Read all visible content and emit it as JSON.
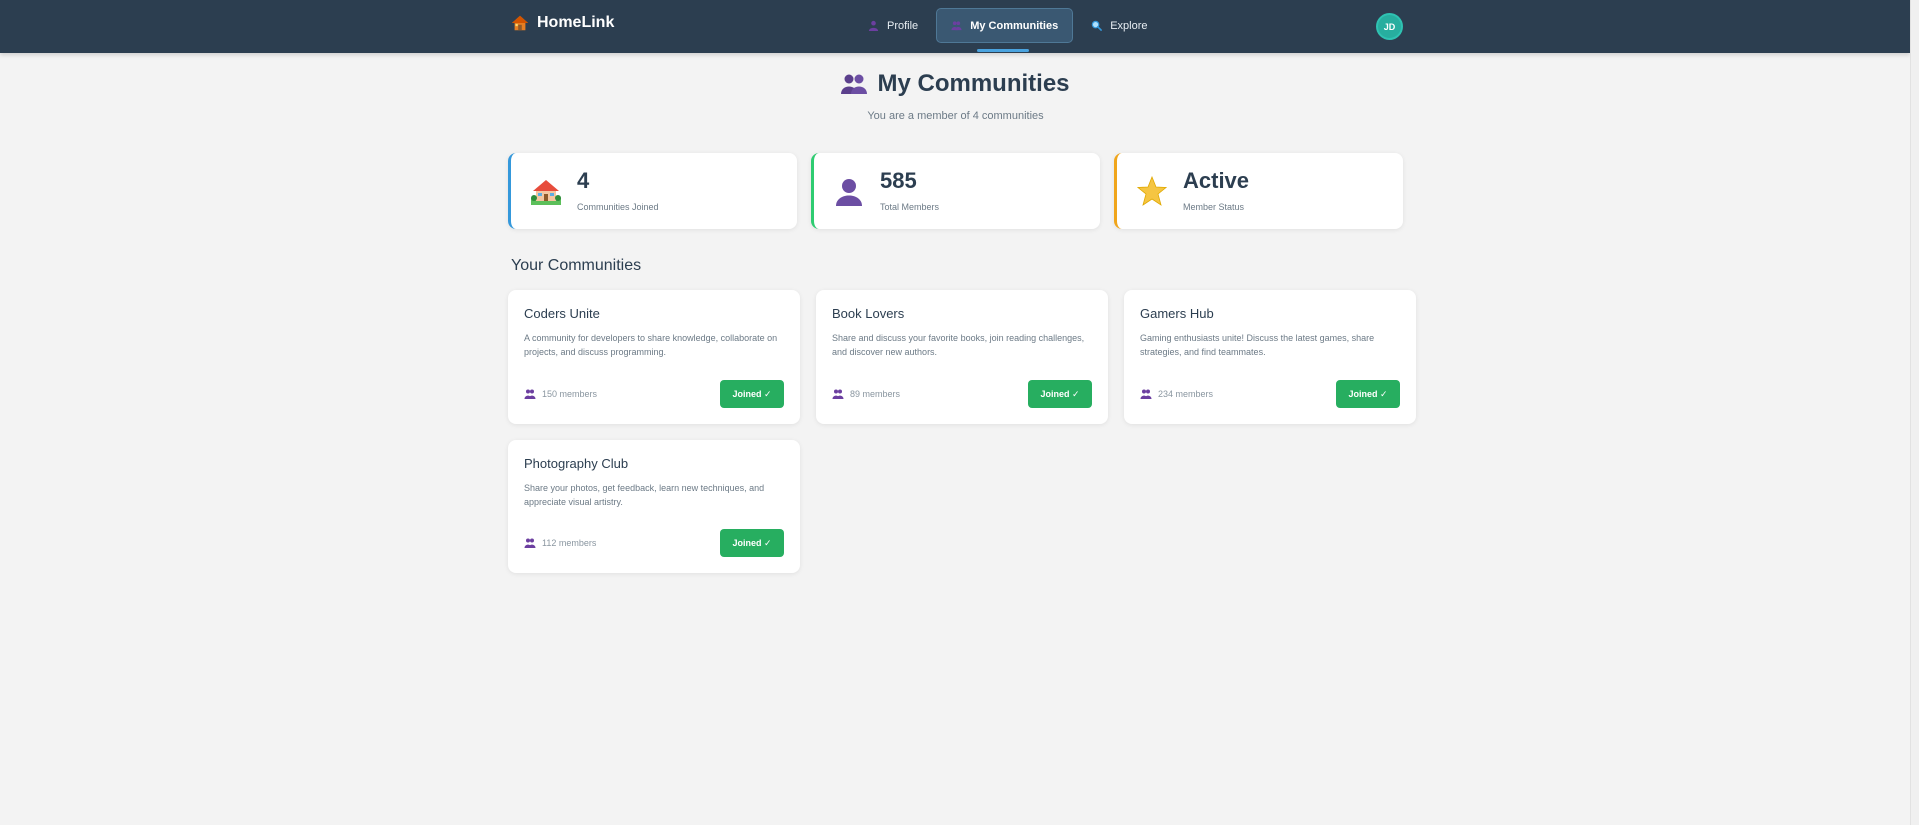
{
  "nav": {
    "brand": "HomeLink",
    "links": [
      {
        "label": "Profile"
      },
      {
        "label": "My Communities"
      },
      {
        "label": "Explore"
      }
    ],
    "avatar_initials": "JD"
  },
  "header": {
    "title": "My Communities",
    "subtitle": "You are a member of 4 communities"
  },
  "stats": [
    {
      "value": "4",
      "label": "Communities Joined"
    },
    {
      "value": "585",
      "label": "Total Members"
    },
    {
      "value": "Active",
      "label": "Member Status"
    }
  ],
  "section_title": "Your Communities",
  "communities": [
    {
      "name": "Coders Unite",
      "description": "A community for developers to share knowledge, collaborate on projects, and discuss programming.",
      "members": "150 members",
      "button": "Joined ✓"
    },
    {
      "name": "Book Lovers",
      "description": "Share and discuss your favorite books, join reading challenges, and discover new authors.",
      "members": "89 members",
      "button": "Joined ✓"
    },
    {
      "name": "Gamers Hub",
      "description": "Gaming enthusiasts unite! Discuss the latest games, share strategies, and find teammates.",
      "members": "234 members",
      "button": "Joined ✓"
    },
    {
      "name": "Photography Club",
      "description": "Share your photos, get feedback, learn new techniques, and appreciate visual artistry.",
      "members": "112 members",
      "button": "Joined ✓"
    }
  ],
  "colors": {
    "navbar": "#2c3e50",
    "accent_blue": "#3498db",
    "accent_green": "#27ae60",
    "accent_orange": "#f0a51b",
    "avatar": "#27ae9f"
  },
  "icons": {
    "brand": "house-icon",
    "profile": "person-icon",
    "communities": "people-icon",
    "explore": "magnifier-icon",
    "stat_communities": "house-garden-icon",
    "stat_members": "person-silhouette-icon",
    "stat_status": "star-icon"
  }
}
